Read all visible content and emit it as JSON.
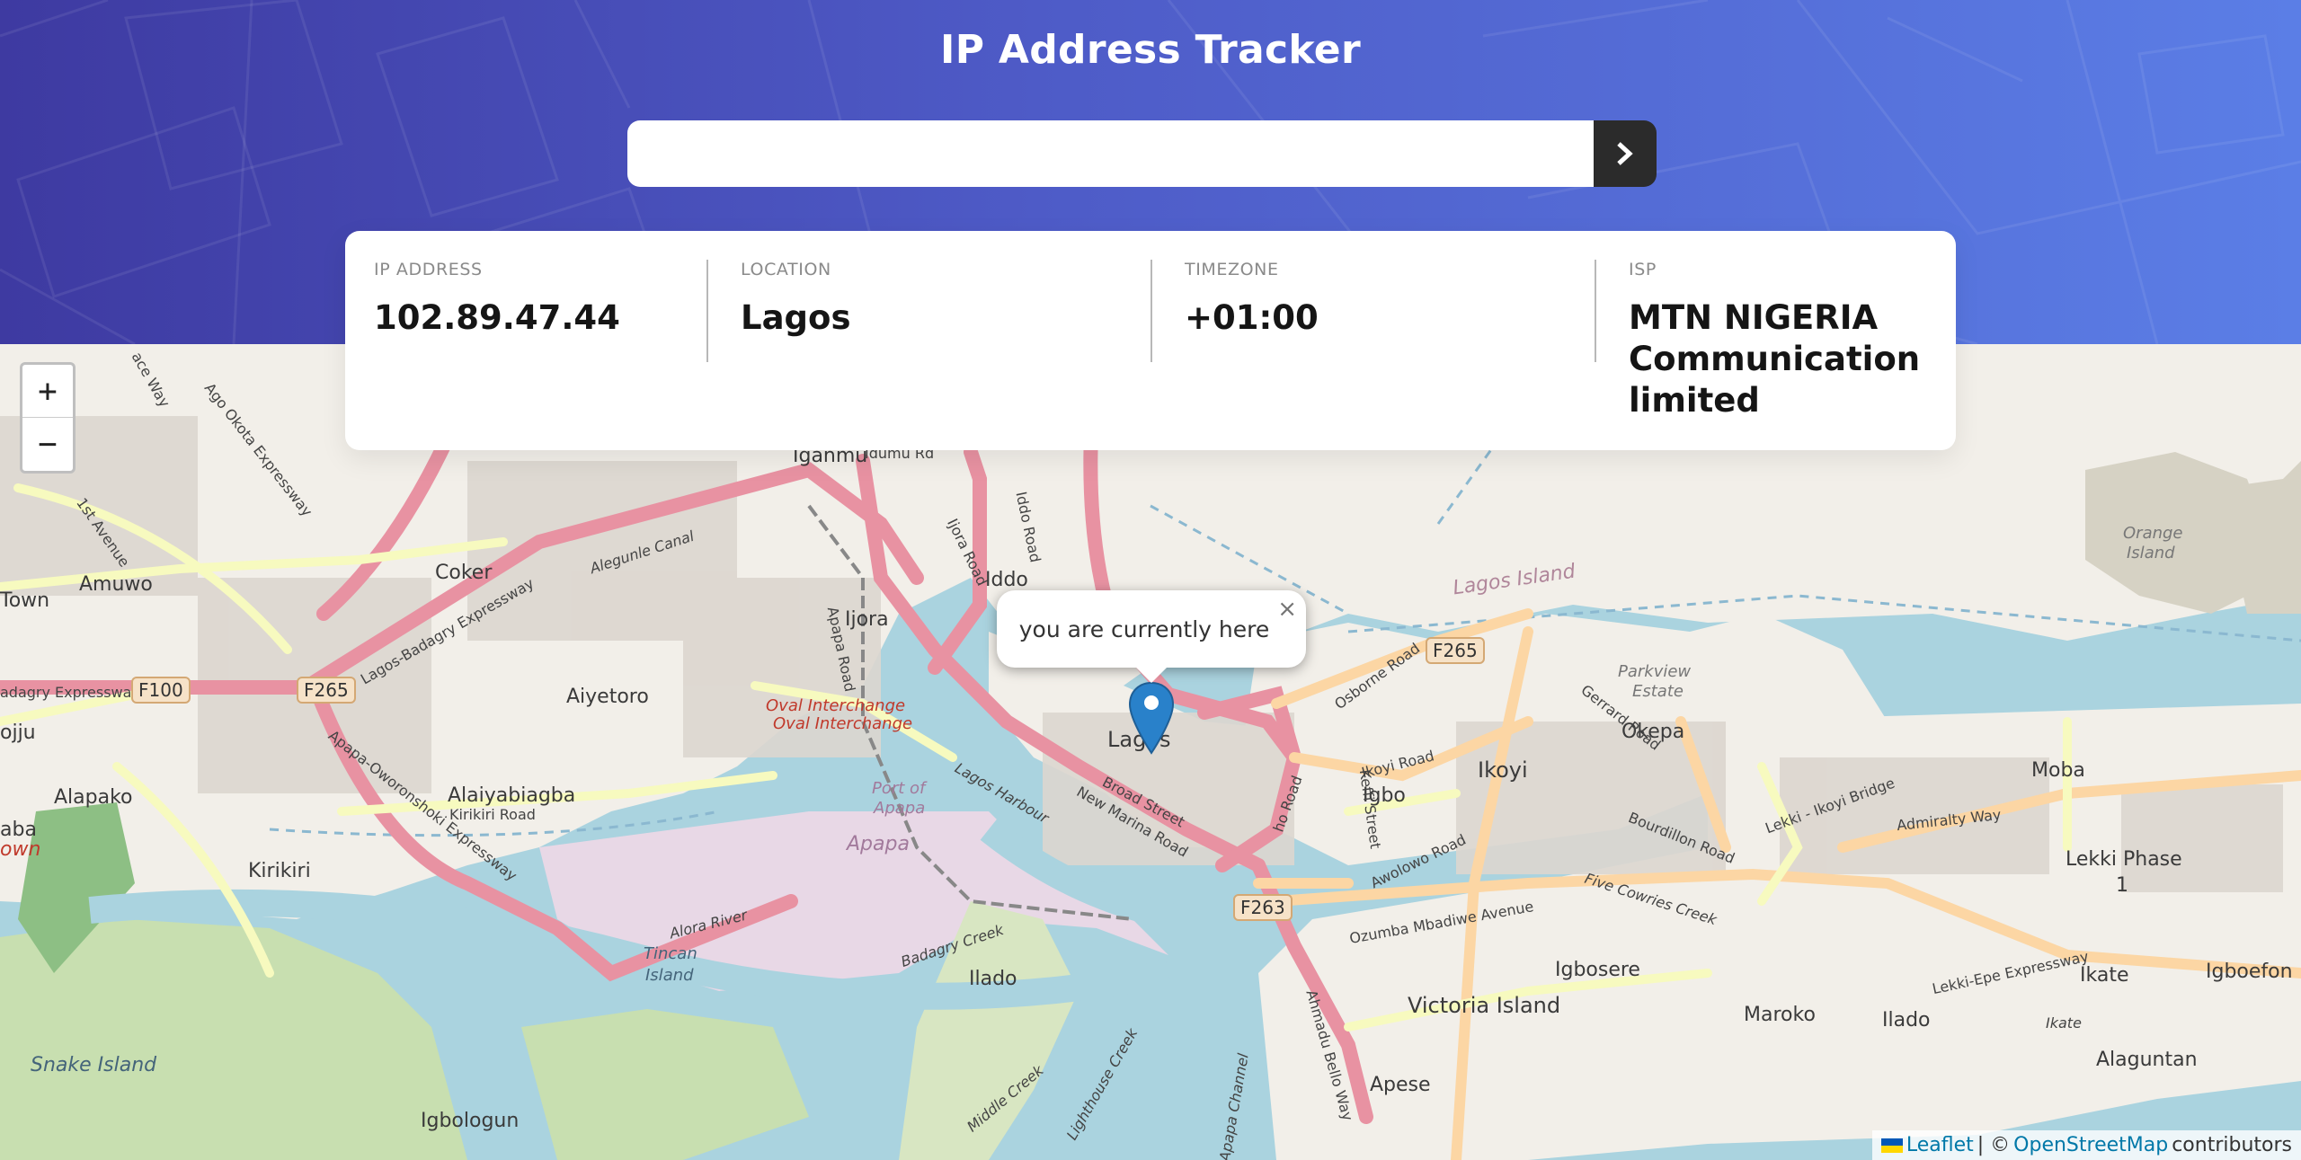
{
  "header": {
    "title": "IP Address Tracker",
    "search": {
      "value": "",
      "placeholder": ""
    },
    "submit_icon": "chevron-right-icon"
  },
  "info": {
    "ip": {
      "label": "IP ADDRESS",
      "value": "102.89.47.44"
    },
    "location": {
      "label": "LOCATION",
      "value": "Lagos"
    },
    "timezone": {
      "label": "TIMEZONE",
      "value": "+01:00"
    },
    "isp": {
      "label": "ISP",
      "value": "MTN NIGERIA Communication limited"
    }
  },
  "map": {
    "zoom_in": "+",
    "zoom_out": "−",
    "popup": {
      "message": "you are currently here",
      "close": "×"
    },
    "labels": {
      "lagos": "Lagos",
      "coker": "Coker",
      "amuwo": "Amuwo",
      "town": "Town",
      "ijora": "Ijora",
      "iddo": "Iddo",
      "aiyetoro": "Aiyetoro",
      "alapako": "Alapako",
      "alaiyabiagba": "Alaiyabiagba",
      "kirikiri": "Kirikiri",
      "ikoyi": "Ikoyi",
      "igbo": "Igbo",
      "okepa": "Okepa",
      "moba": "Moba",
      "lekki_phase": "Lekki Phase",
      "lekki_phase_num": "1",
      "victoria_island": "Victoria Island",
      "igbosere": "Igbosere",
      "maroko": "Maroko",
      "ilado": "Ilado",
      "ikate": "Ikate",
      "igboefon": "Igboefon",
      "alaguntan": "Alaguntan",
      "apese": "Apese",
      "igbologun": "Igbologun",
      "snake_island": "Snake Island",
      "tincan": "Tincan",
      "tincan_island": "Island",
      "apapa": "Apapa",
      "port_of": "Port of",
      "port_apapa": "Apapa",
      "oval_1": "Oval Interchange",
      "oval_2": "Oval Interchange",
      "lagos_island": "Lagos Island",
      "orange": "Orange",
      "orange_island": "Island",
      "parkview": "Parkview",
      "parkview_estate": "Estate",
      "ilado2": "Ilado",
      "ojuju": "ojju",
      "aba": "aba",
      "own": "own",
      "badagry_expressway": "adagry Expressway",
      "lagos_badagry": "Lagos-Badagry Expressway",
      "ago_okota": "Ago Okota Expressway",
      "first_avenue": "1st Avenue",
      "apapa_oworo": "Apapa-Oworonshoki Expressway",
      "kirikiri_road": "Kirikiri Road",
      "broad_street": "Broad Street",
      "new_marina": "New Marina Road",
      "osborne": "Osborne Road",
      "gerrard": "Gerrard Road",
      "awolowo": "Awolowo Road",
      "ikoyi_road": "Ikoyi Road",
      "bourdillon": "Bourdillon Road",
      "ozumba": "Ozumba Mbadiwe Avenue",
      "five_cowries": "Five Cowries Creek",
      "admiralty": "Admiralty Way",
      "lekki_ikoyi": "Lekki - Ikoyi Bridge",
      "lekki_epe": "Lekki-Epe Expressway",
      "ahmadu_bello": "Ahmadu Bello Way",
      "badagry_creek": "Badagry Creek",
      "lagos_harbour": "Lagos Harbour",
      "apapa_road": "Apapa Road",
      "ijora_road": "Ijora Road",
      "iddo_road": "Iddo Road",
      "middle_creek": "Middle Creek",
      "lighthouse_creek": "Lighthouse Creek",
      "alora_river": "Alora River",
      "agege_canal": "Alegunle Canal",
      "ago_way": "ace Way",
      "ipanmu": "Iganmu",
      "lewis_rd": "Idumu Rd",
      "ikate2": "Ikate",
      "channel": "Apapa Channel",
      "keffi": "Keffi Street",
      "oko_way": "ho Road"
    },
    "shields": {
      "f100": "F100",
      "f265_a": "F265",
      "f265_b": "F265",
      "f263": "F263"
    },
    "attribution": {
      "leaflet": "Leaflet",
      "separator": "| ©",
      "osm": "OpenStreetMap",
      "contributors": "contributors"
    }
  },
  "colors": {
    "header_gradient_start": "#3e3aa1",
    "header_gradient_end": "#5b7ee6",
    "button_bg": "#2b2b2b",
    "marker_blue": "#2981ca",
    "water": "#aad3df",
    "land": "#f2efe9"
  }
}
